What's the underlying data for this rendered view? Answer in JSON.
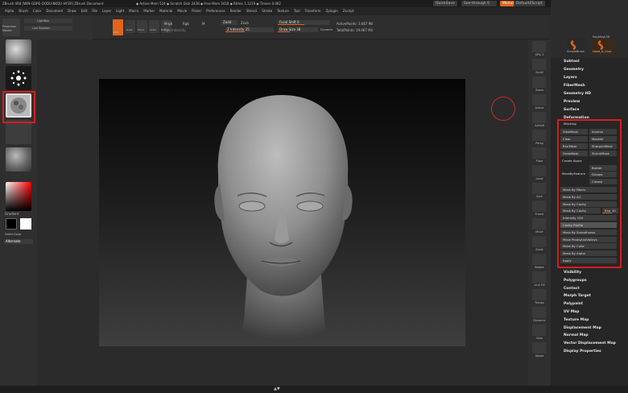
{
  "titlebar": {
    "left": "ZBrush 4R8 [WIN-GDPE-QODU-NKQU-HY3R]    ZBrush Document",
    "center": "◆ Active Mem 524 ◆ Scratch Disk 2438 ◆ Free Mem 3418 ◆ Rtime 1.1219 ◆ Timers 0.062",
    "quicksave": "QuickSave",
    "seethrough": "See-through 0",
    "menus": "Menus",
    "defaultscript": "DefaultZScript"
  },
  "menubar": [
    "Alpha",
    "Brush",
    "Color",
    "Document",
    "Draw",
    "Edit",
    "File",
    "Layer",
    "Light",
    "Macro",
    "Marker",
    "Material",
    "Movie",
    "Picker",
    "Preferences",
    "Render",
    "Stencil",
    "Stroke",
    "Texture",
    "Tool",
    "Transform",
    "Zplugin",
    "Zscript"
  ],
  "toptools": {
    "projection": "Projection",
    "master": "Master",
    "lightbox": "LightBox",
    "liveboolean": "Live Boolean",
    "edit": "Edit",
    "draw": "Draw",
    "move": "Move",
    "scale": "Scale",
    "rotate": "Rotate",
    "mrgb": "Mrgb",
    "rgb": "Rgb",
    "m": "M",
    "rgb_intensity": "Rgb Intensity",
    "zadd": "Zadd",
    "zsub": "Zsub",
    "z_intensity": "Z Intensity 25",
    "focal_shift": "Focal Shift 0",
    "draw_size": "Draw Size 38",
    "dynamic": "Dynamic",
    "active_points": "ActivePoints: 3.667 Mil",
    "total_points": "TotalPoints: 19.067 Mil"
  },
  "leftpanel": {
    "gradient": "Gradient",
    "switchcolor": "SwitchColor",
    "alternate": "Alternate"
  },
  "rightshelf": [
    "SPix 3",
    "Scroll",
    "Zoom",
    "Actual",
    "AAHalf",
    "Persp",
    "Floor",
    "Local",
    "Sym",
    "Frame",
    "Move",
    "Scale",
    "Rotate",
    "Line Fill",
    "Transp",
    "Dynamic",
    "Solo",
    "Xpose"
  ],
  "tray_header": {
    "simplebrush": "SimpleBrush",
    "polymesh": "PolyMesh3D",
    "head": "Head_A_Unre"
  },
  "tool_menu": [
    "Subtool",
    "Geometry",
    "Layers",
    "FiberMesh",
    "Geometry HD",
    "Preview",
    "Surface",
    "Deformation"
  ],
  "masking": {
    "title": "Masking",
    "buttons": [
      "ViewMask",
      "Inverse",
      "Clear",
      "MaskAll",
      "BlurMask",
      "SharpenMask",
      "GrowMask",
      "ShrinkMask"
    ],
    "create_alpha": "Create Alpha",
    "mask_by_feature": "MaskByFeature",
    "feature_opts": [
      "Border",
      "Groups",
      "Crease"
    ],
    "items": [
      "Mask By Fibers",
      "Mask By AO",
      "Mask By Cavity",
      "Mask By Cavity",
      "Intensity 100",
      "Cavity Profile",
      "Mask By Smoothness",
      "Mask PeaksAndValleys",
      "Mask By Color",
      "Mask By Alpha",
      "Apply"
    ],
    "blur": "Blur 10"
  },
  "tool_menu2": [
    "Visibility",
    "Polygroups",
    "Contact",
    "Morph Target",
    "Polypaint",
    "UV Map",
    "Texture Map",
    "Displacement Map",
    "Normal Map",
    "Vector Displacement Map",
    "Display Properties"
  ],
  "colors": {
    "accent": "#e0641c",
    "highlight": "#d71d1d",
    "bg": "#2b2b2b"
  }
}
